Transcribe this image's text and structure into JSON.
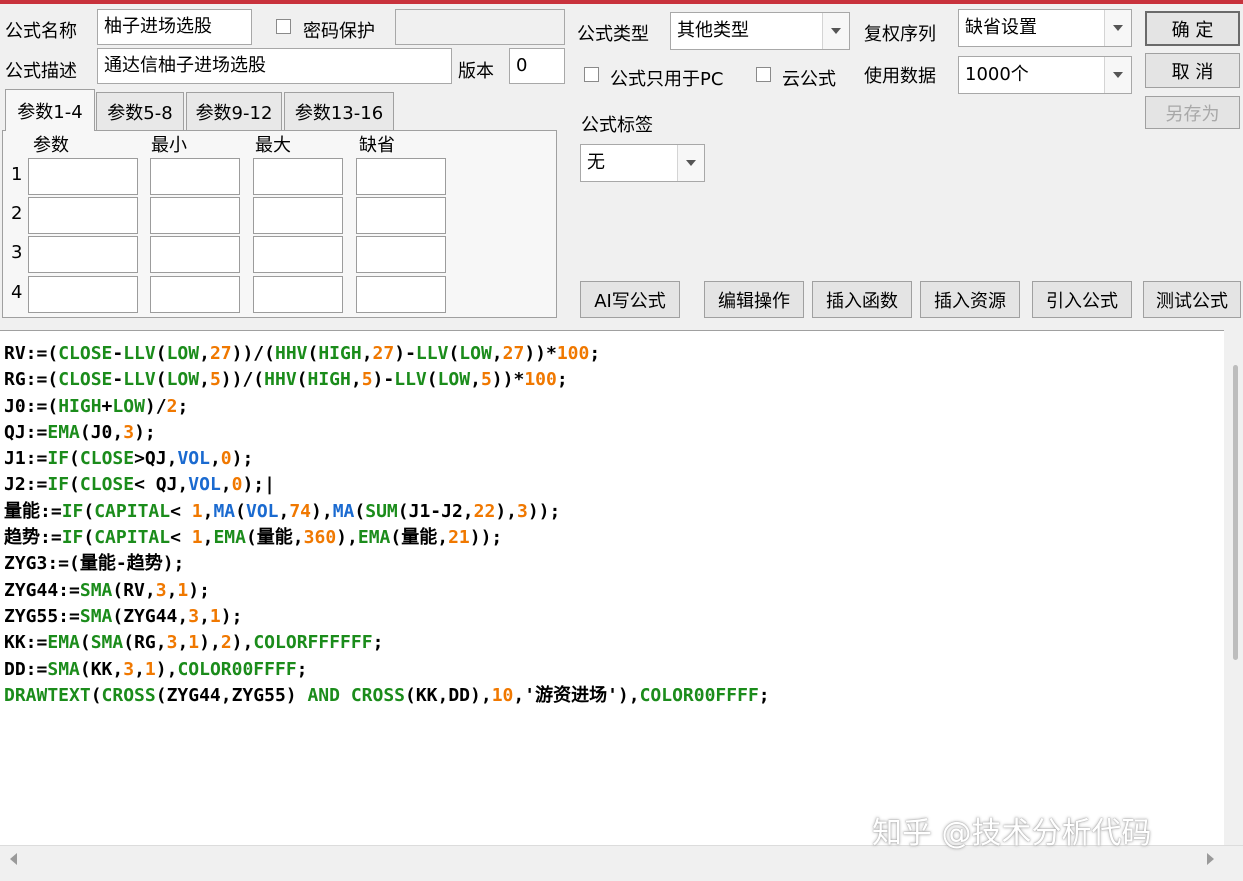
{
  "form": {
    "name_label": "公式名称",
    "name_value": "柚子进场选股",
    "password_label": "密码保护",
    "desc_label": "公式描述",
    "desc_value": "通达信柚子进场选股",
    "version_label": "版本",
    "version_value": "0",
    "type_label": "公式类型",
    "type_value": "其他类型",
    "pc_only_label": "公式只用于PC",
    "cloud_label": "云公式",
    "rights_label": "复权序列",
    "rights_value": "缺省设置",
    "data_label": "使用数据",
    "data_value": "1000个",
    "tag_label": "公式标签",
    "tag_value": "无"
  },
  "buttons": {
    "ok": "确  定",
    "cancel": "取  消",
    "save_as": "另存为",
    "ai_write": "AI写公式",
    "edit_ops": "编辑操作",
    "insert_func": "插入函数",
    "insert_res": "插入资源",
    "import_formula": "引入公式",
    "test_formula": "测试公式"
  },
  "tabs": [
    "参数1-4",
    "参数5-8",
    "参数9-12",
    "参数13-16"
  ],
  "params": {
    "headers": [
      "参数",
      "最小",
      "最大",
      "缺省"
    ],
    "rows": [
      "1",
      "2",
      "3",
      "4"
    ]
  },
  "colors": {
    "kw": "#1b8c1b",
    "num": "#f07800",
    "blue": "#1a6ad0",
    "text": "#000000",
    "titlebar": "#c8323c"
  },
  "code_lines": [
    [
      [
        "RV:=(",
        "t"
      ],
      [
        "CLOSE",
        "kw"
      ],
      [
        "-",
        "t"
      ],
      [
        "LLV",
        "kw"
      ],
      [
        "(",
        "t"
      ],
      [
        "LOW",
        "kw"
      ],
      [
        ",",
        "t"
      ],
      [
        "27",
        "num"
      ],
      [
        "))/(",
        "t"
      ],
      [
        "HHV",
        "kw"
      ],
      [
        "(",
        "t"
      ],
      [
        "HIGH",
        "kw"
      ],
      [
        ",",
        "t"
      ],
      [
        "27",
        "num"
      ],
      [
        ")-",
        "t"
      ],
      [
        "LLV",
        "kw"
      ],
      [
        "(",
        "t"
      ],
      [
        "LOW",
        "kw"
      ],
      [
        ",",
        "t"
      ],
      [
        "27",
        "num"
      ],
      [
        "))*",
        "t"
      ],
      [
        "100",
        "num"
      ],
      [
        ";",
        "t"
      ]
    ],
    [
      [
        "RG:=(",
        "t"
      ],
      [
        "CLOSE",
        "kw"
      ],
      [
        "-",
        "t"
      ],
      [
        "LLV",
        "kw"
      ],
      [
        "(",
        "t"
      ],
      [
        "LOW",
        "kw"
      ],
      [
        ",",
        "t"
      ],
      [
        "5",
        "num"
      ],
      [
        "))/(",
        "t"
      ],
      [
        "HHV",
        "kw"
      ],
      [
        "(",
        "t"
      ],
      [
        "HIGH",
        "kw"
      ],
      [
        ",",
        "t"
      ],
      [
        "5",
        "num"
      ],
      [
        ")-",
        "t"
      ],
      [
        "LLV",
        "kw"
      ],
      [
        "(",
        "t"
      ],
      [
        "LOW",
        "kw"
      ],
      [
        ",",
        "t"
      ],
      [
        "5",
        "num"
      ],
      [
        "))*",
        "t"
      ],
      [
        "100",
        "num"
      ],
      [
        ";",
        "t"
      ]
    ],
    [
      [
        "J0:=(",
        "t"
      ],
      [
        "HIGH",
        "kw"
      ],
      [
        "+",
        "t"
      ],
      [
        "LOW",
        "kw"
      ],
      [
        ")/",
        "t"
      ],
      [
        "2",
        "num"
      ],
      [
        ";",
        "t"
      ]
    ],
    [
      [
        "QJ:=",
        "t"
      ],
      [
        "EMA",
        "kw"
      ],
      [
        "(J0,",
        "t"
      ],
      [
        "3",
        "num"
      ],
      [
        ");",
        "t"
      ]
    ],
    [
      [
        "J1:=",
        "t"
      ],
      [
        "IF",
        "kw"
      ],
      [
        "(",
        "t"
      ],
      [
        "CLOSE",
        "kw"
      ],
      [
        ">QJ,",
        "t"
      ],
      [
        "VOL",
        "blue"
      ],
      [
        ",",
        "t"
      ],
      [
        "0",
        "num"
      ],
      [
        ");",
        "t"
      ]
    ],
    [
      [
        "J2:=",
        "t"
      ],
      [
        "IF",
        "kw"
      ],
      [
        "(",
        "t"
      ],
      [
        "CLOSE",
        "kw"
      ],
      [
        "< QJ,",
        "t"
      ],
      [
        "VOL",
        "blue"
      ],
      [
        ",",
        "t"
      ],
      [
        "0",
        "num"
      ],
      [
        ");|",
        "t"
      ]
    ],
    [
      [
        "量能:=",
        "t"
      ],
      [
        "IF",
        "kw"
      ],
      [
        "(",
        "t"
      ],
      [
        "CAPITAL",
        "kw"
      ],
      [
        "< ",
        "t"
      ],
      [
        "1",
        "num"
      ],
      [
        ",",
        "t"
      ],
      [
        "MA",
        "blue"
      ],
      [
        "(",
        "t"
      ],
      [
        "VOL",
        "blue"
      ],
      [
        ",",
        "t"
      ],
      [
        "74",
        "num"
      ],
      [
        "),",
        "t"
      ],
      [
        "MA",
        "blue"
      ],
      [
        "(",
        "t"
      ],
      [
        "SUM",
        "kw"
      ],
      [
        "(J1-J2,",
        "t"
      ],
      [
        "22",
        "num"
      ],
      [
        "),",
        "t"
      ],
      [
        "3",
        "num"
      ],
      [
        "));",
        "t"
      ]
    ],
    [
      [
        "趋势:=",
        "t"
      ],
      [
        "IF",
        "kw"
      ],
      [
        "(",
        "t"
      ],
      [
        "CAPITAL",
        "kw"
      ],
      [
        "< ",
        "t"
      ],
      [
        "1",
        "num"
      ],
      [
        ",",
        "t"
      ],
      [
        "EMA",
        "kw"
      ],
      [
        "(量能,",
        "t"
      ],
      [
        "360",
        "num"
      ],
      [
        "),",
        "t"
      ],
      [
        "EMA",
        "kw"
      ],
      [
        "(量能,",
        "t"
      ],
      [
        "21",
        "num"
      ],
      [
        "));",
        "t"
      ]
    ],
    [
      [
        "ZYG3:=(量能-趋势);",
        "t"
      ]
    ],
    [
      [
        "ZYG44:=",
        "t"
      ],
      [
        "SMA",
        "kw"
      ],
      [
        "(RV,",
        "t"
      ],
      [
        "3",
        "num"
      ],
      [
        ",",
        "t"
      ],
      [
        "1",
        "num"
      ],
      [
        ");",
        "t"
      ]
    ],
    [
      [
        "ZYG55:=",
        "t"
      ],
      [
        "SMA",
        "kw"
      ],
      [
        "(ZYG44,",
        "t"
      ],
      [
        "3",
        "num"
      ],
      [
        ",",
        "t"
      ],
      [
        "1",
        "num"
      ],
      [
        ");",
        "t"
      ]
    ],
    [
      [
        "KK:=",
        "t"
      ],
      [
        "EMA",
        "kw"
      ],
      [
        "(",
        "t"
      ],
      [
        "SMA",
        "kw"
      ],
      [
        "(RG,",
        "t"
      ],
      [
        "3",
        "num"
      ],
      [
        ",",
        "t"
      ],
      [
        "1",
        "num"
      ],
      [
        "),",
        "t"
      ],
      [
        "2",
        "num"
      ],
      [
        "),",
        "t"
      ],
      [
        "COLORFFFFFF",
        "kw"
      ],
      [
        ";",
        "t"
      ]
    ],
    [
      [
        "DD:=",
        "t"
      ],
      [
        "SMA",
        "kw"
      ],
      [
        "(KK,",
        "t"
      ],
      [
        "3",
        "num"
      ],
      [
        ",",
        "t"
      ],
      [
        "1",
        "num"
      ],
      [
        "),",
        "t"
      ],
      [
        "COLOR00FFFF",
        "kw"
      ],
      [
        ";",
        "t"
      ]
    ],
    [
      [
        "DRAWTEXT",
        "kw"
      ],
      [
        "(",
        "t"
      ],
      [
        "CROSS",
        "kw"
      ],
      [
        "(ZYG44,ZYG55) ",
        "t"
      ],
      [
        "AND",
        "kw"
      ],
      [
        " ",
        "t"
      ],
      [
        "CROSS",
        "kw"
      ],
      [
        "(KK,DD),",
        "t"
      ],
      [
        "10",
        "num"
      ],
      [
        ",'游资进场'),",
        "t"
      ],
      [
        "COLOR00FFFF",
        "kw"
      ],
      [
        ";",
        "t"
      ]
    ]
  ],
  "watermark": "知乎 @技术分析代码"
}
